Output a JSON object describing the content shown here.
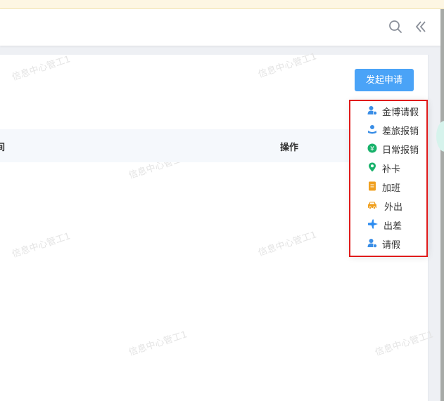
{
  "header": {
    "search_icon": "search-icon",
    "collapse_icon": "double-chevron-left-icon"
  },
  "toolbar": {
    "start_request_label": "发起申请"
  },
  "table": {
    "columns": [
      "间",
      "操作"
    ]
  },
  "watermark": {
    "text": "信息中心管工1"
  },
  "dropdown": {
    "items": [
      {
        "label": "金博请假",
        "icon": "user-leave-icon",
        "color": "#3a8ee6"
      },
      {
        "label": "差旅报销",
        "icon": "user-travel-icon",
        "color": "#3a8ee6"
      },
      {
        "label": "日常报销",
        "icon": "yen-circle-icon",
        "color": "#19b26b"
      },
      {
        "label": "补卡",
        "icon": "location-pin-icon",
        "color": "#19b26b"
      },
      {
        "label": "加班",
        "icon": "document-icon",
        "color": "#f0a020"
      },
      {
        "label": "外出",
        "icon": "car-icon",
        "color": "#f0a020"
      },
      {
        "label": "出差",
        "icon": "airplane-icon",
        "color": "#2d8cf0"
      },
      {
        "label": "请假",
        "icon": "user-leave-icon",
        "color": "#3a8ee6"
      }
    ]
  },
  "colors": {
    "primary": "#4aa3f7",
    "highlight_border": "#e01b1b"
  }
}
